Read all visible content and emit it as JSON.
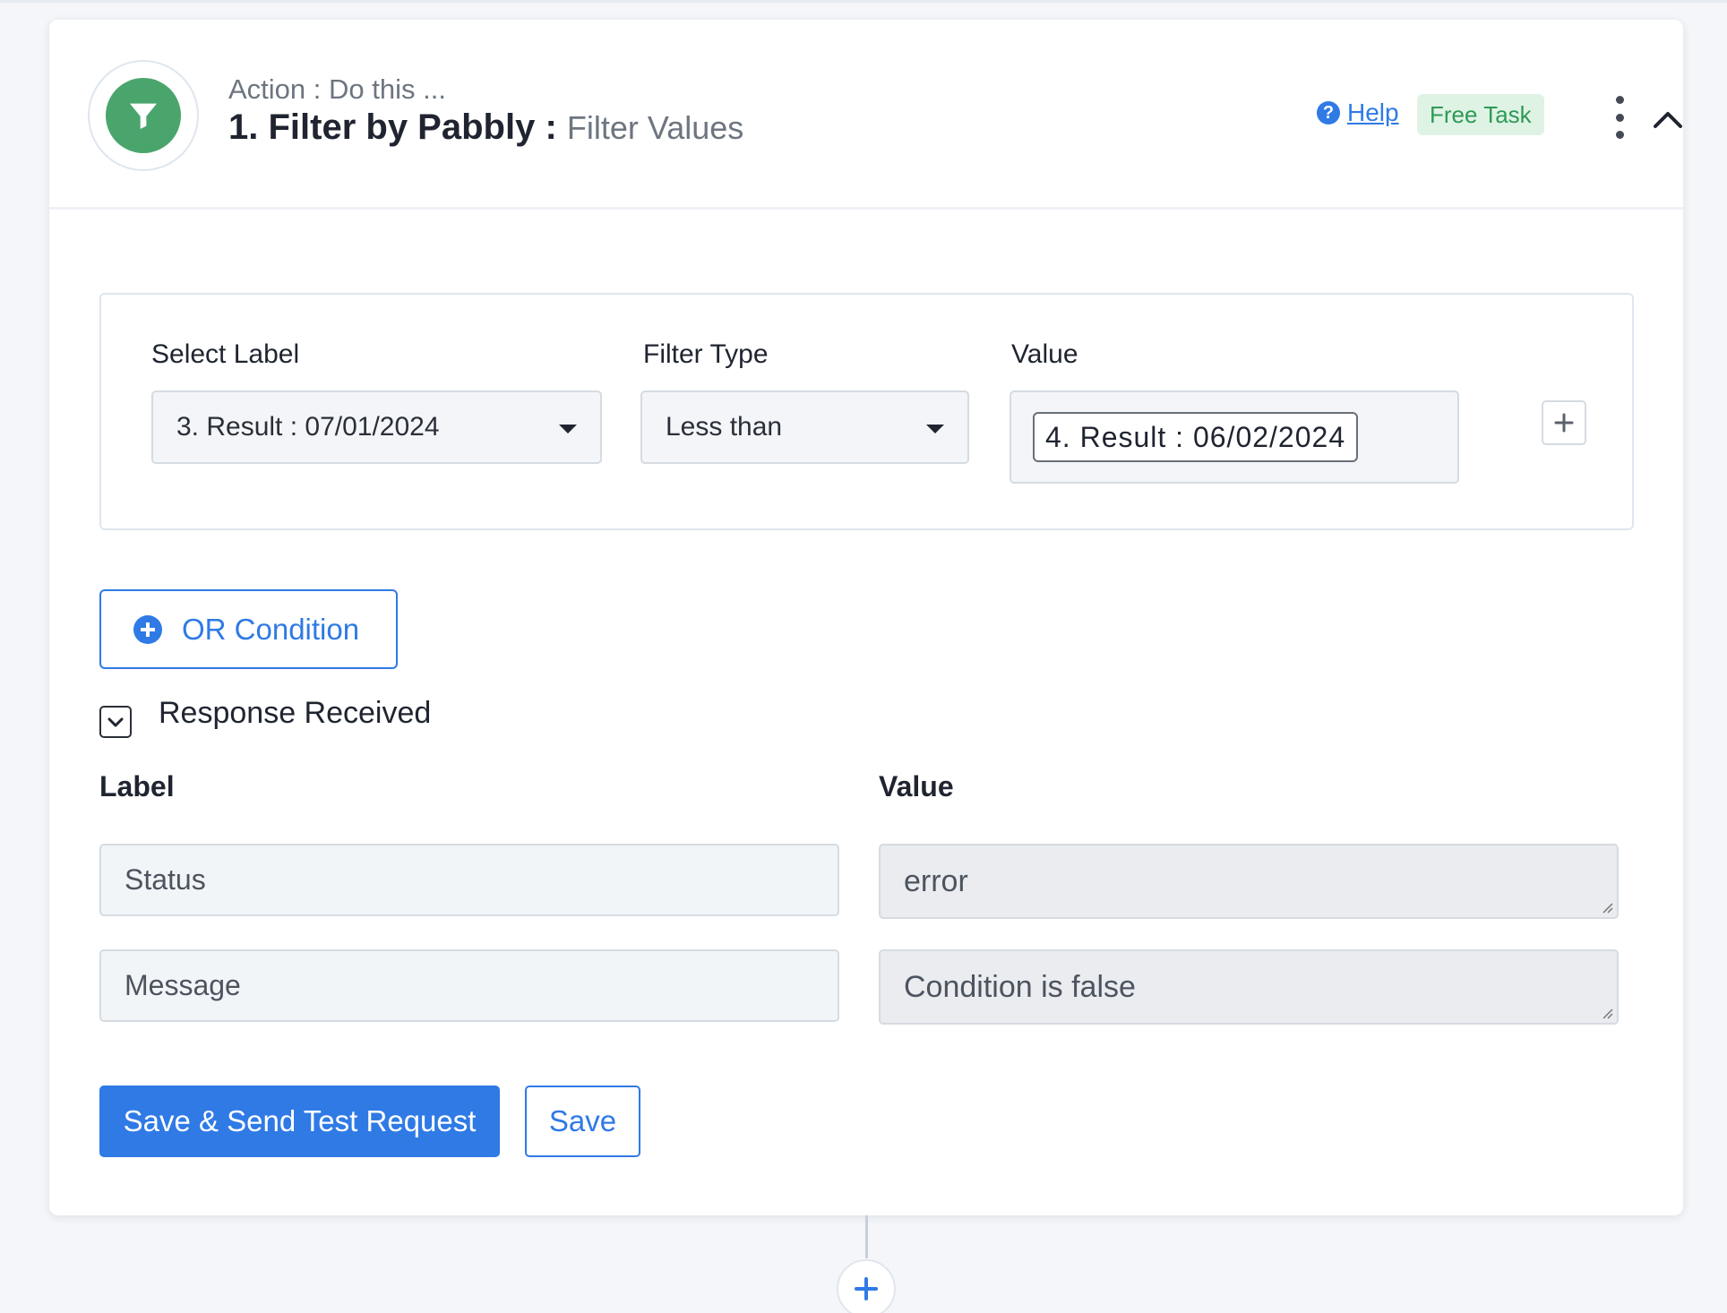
{
  "header": {
    "subtitle": "Action : Do this ...",
    "title": "1. Filter by Pabbly :",
    "event_name": "Filter Values",
    "help_label": "Help",
    "task_badge": "Free Task",
    "logo_icon": "filter-icon",
    "brand_color": "#4aa56c"
  },
  "filter": {
    "select_label_heading": "Select Label",
    "filter_type_heading": "Filter Type",
    "value_heading": "Value",
    "selected_label": "3. Result : 07/01/2024",
    "selected_filter_type": "Less than",
    "value_token": "4. Result : 06/02/2024"
  },
  "or_condition_label": "OR Condition",
  "response": {
    "title": "Response Received",
    "label_heading": "Label",
    "value_heading": "Value",
    "rows": [
      {
        "label": "Status",
        "value": "error"
      },
      {
        "label": "Message",
        "value": "Condition is false"
      }
    ]
  },
  "buttons": {
    "save_and_send": "Save & Send Test Request",
    "save": "Save"
  },
  "colors": {
    "accent": "#2f7ae5",
    "badge_bg": "#dff3e5",
    "badge_text": "#2e9a55"
  }
}
